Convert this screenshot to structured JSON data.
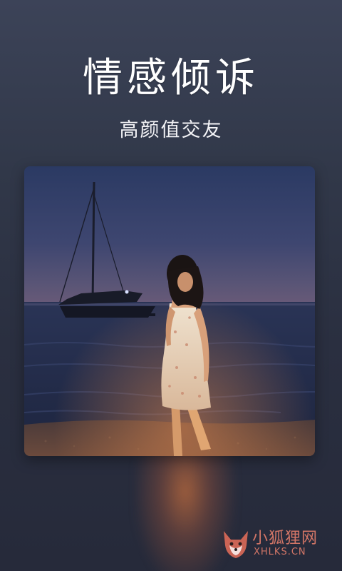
{
  "hero": {
    "title": "情感倾诉",
    "subtitle": "高颜值交友"
  },
  "photo": {
    "subject": "woman-on-beach-at-dusk"
  },
  "watermark": {
    "title": "小狐狸网",
    "domain": "XHLKS.CN"
  },
  "colors": {
    "background": "#2f3546",
    "title_text": "#ffffff",
    "watermark": "#f0826e",
    "glow": "#c46e3e"
  }
}
